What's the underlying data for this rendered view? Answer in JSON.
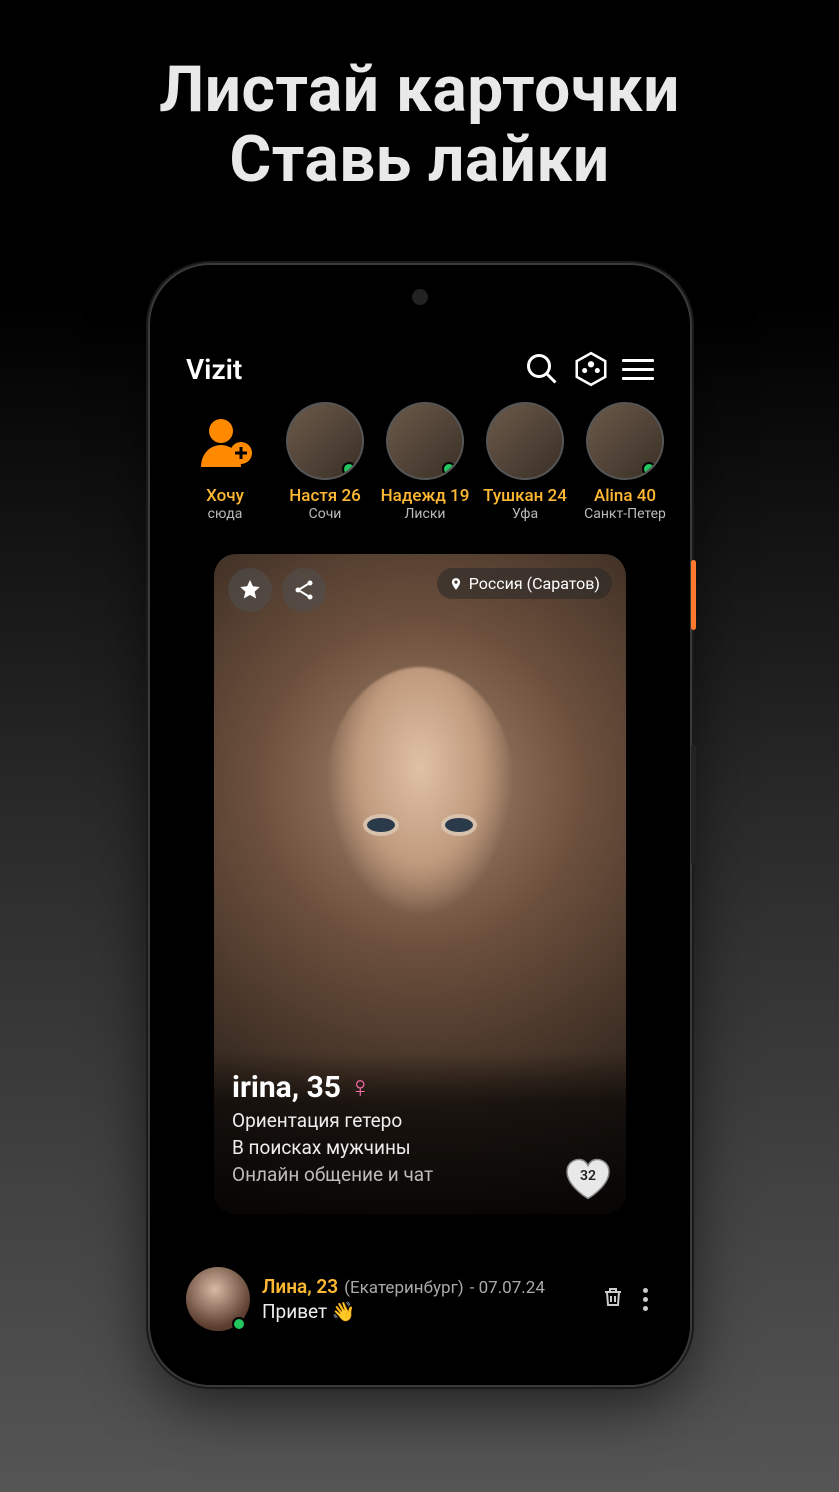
{
  "marketing": {
    "line1": "Листай карточки",
    "line2": "Ставь лайки"
  },
  "header": {
    "title": "Vizit"
  },
  "stories": [
    {
      "name": "Хочу",
      "city": "сюда",
      "add": true
    },
    {
      "name": "Настя 26",
      "city": "Сочи",
      "online": true
    },
    {
      "name": "Надежд 19",
      "city": "Лиски",
      "online": true
    },
    {
      "name": "Тушкан 24",
      "city": "Уфа",
      "online": false
    },
    {
      "name": "Alina 40",
      "city": "Санкт-Петер",
      "online": true
    }
  ],
  "card": {
    "location": "Россия (Саратов)",
    "name_age": "irina, 35",
    "line1": "Ориентация гетеро",
    "line2": "В поисках мужчины",
    "line3": "Онлайн общение и чат",
    "likes": "32"
  },
  "message": {
    "name_age": "Лина, 23",
    "city": "(Екатеринбург)",
    "date": "- 07.07.24",
    "text": "Привет 👋"
  }
}
